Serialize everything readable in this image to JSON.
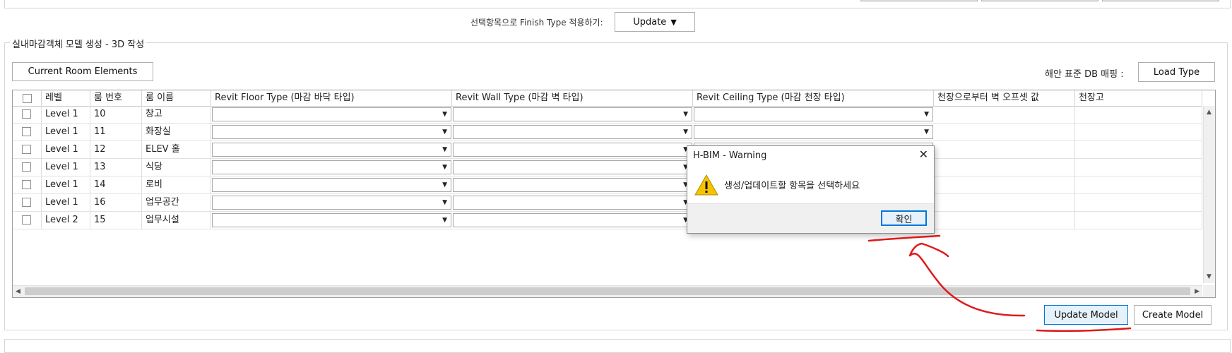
{
  "apply": {
    "label": "선택항목으로 Finish Type 적용하기:",
    "update_label": "Update",
    "update_arrow": "▼"
  },
  "group_title": "실내마감객체 모델 생성 - 3D 작성",
  "current_room_button": "Current Room Elements",
  "mapping": {
    "label": "해안 표준 DB 매핑 :",
    "load_button": "Load Type"
  },
  "table": {
    "headers": [
      "레벨",
      "룸 번호",
      "룸 이름",
      "Revit Floor Type (마감 바닥 타입)",
      "Revit Wall Type (마감 벽 타입)",
      "Revit Ceiling Type (마감 천장 타입)",
      "천장으로부터 벽 오프셋 값",
      "천장고"
    ],
    "rows": [
      {
        "level": "Level 1",
        "number": "10",
        "name": "창고"
      },
      {
        "level": "Level 1",
        "number": "11",
        "name": "화장실"
      },
      {
        "level": "Level 1",
        "number": "12",
        "name": "ELEV 홀"
      },
      {
        "level": "Level 1",
        "number": "13",
        "name": "식당"
      },
      {
        "level": "Level 1",
        "number": "14",
        "name": "로비"
      },
      {
        "level": "Level 1",
        "number": "16",
        "name": "업무공간"
      },
      {
        "level": "Level 2",
        "number": "15",
        "name": "업무시설"
      }
    ]
  },
  "dialog": {
    "title": "H-BIM - Warning",
    "message": "생성/업데이트할 항목을 선택하세요",
    "ok": "확인",
    "close": "✕"
  },
  "buttons": {
    "update_model": "Update Model",
    "create_model": "Create Model"
  },
  "colors": {
    "annotation": "#e0191b",
    "dialog_ok_border": "#0078d7",
    "warning_icon": "#f5c400"
  }
}
